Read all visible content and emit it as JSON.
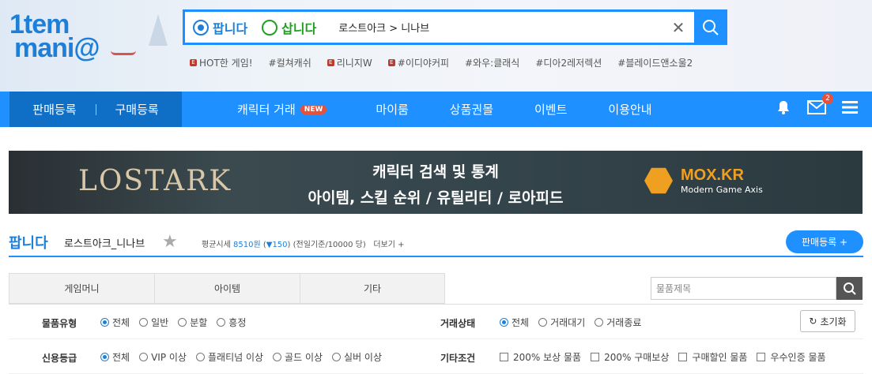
{
  "header": {
    "logo_line1": "1tem",
    "logo_line2": "mani@",
    "search": {
      "sell_label": "팝니다",
      "buy_label": "삽니다",
      "query": "로스트아크 > 니나브"
    },
    "hot_keywords": [
      "HOT한 게임!",
      "#컬쳐캐쉬",
      "리니지W",
      "#이디야커피",
      "#와우:클래식",
      "#디아2레저렉션",
      "#블레이드앤소울2"
    ]
  },
  "nav": {
    "sell_register": "판매등록",
    "buy_register": "구매등록",
    "menu": [
      "캐릭터 거래",
      "마이룸",
      "상품권몰",
      "이벤트",
      "이용안내"
    ],
    "new_badge": "NEW",
    "mail_count": "2"
  },
  "banner": {
    "game_logo": "LOSTARK",
    "line1": "캐릭터 검색 및 통계",
    "line2": "아이템, 스킬 순위 / 유틸리티 / 로아피드",
    "brand": "MOX.KR",
    "brand_sub": "Modern Game Axis"
  },
  "title": {
    "heading": "팝니다",
    "game": "로스트아크_니나브",
    "avg_label": "평균시세",
    "avg_price": "8510원",
    "change": "▼150",
    "note": "(전일기준/10000 당)",
    "more": "더보기 +",
    "register_button": "판매등록 +"
  },
  "tabs": [
    "게임머니",
    "아이템",
    "기타"
  ],
  "filter_search_placeholder": "물품제목",
  "filters": {
    "item_type_label": "물품유형",
    "item_type_options": [
      "전체",
      "일반",
      "분할",
      "흥정"
    ],
    "trade_status_label": "거래상태",
    "trade_status_options": [
      "전체",
      "거래대기",
      "거래종료"
    ],
    "reset_label": "초기화",
    "credit_label": "신용등급",
    "credit_options": [
      "전체",
      "VIP 이상",
      "플래티넘 이상",
      "골드 이상",
      "실버 이상"
    ],
    "etc_label": "기타조건",
    "etc_options": [
      "200% 보상 물품",
      "200% 구매보상",
      "구매할인 물품",
      "우수인증 물품"
    ]
  },
  "colors": {
    "brand_blue": "#1e90ff",
    "dark_blue": "#0f6fc6",
    "buy_green": "#20a020",
    "badge_red": "#e8503a"
  }
}
